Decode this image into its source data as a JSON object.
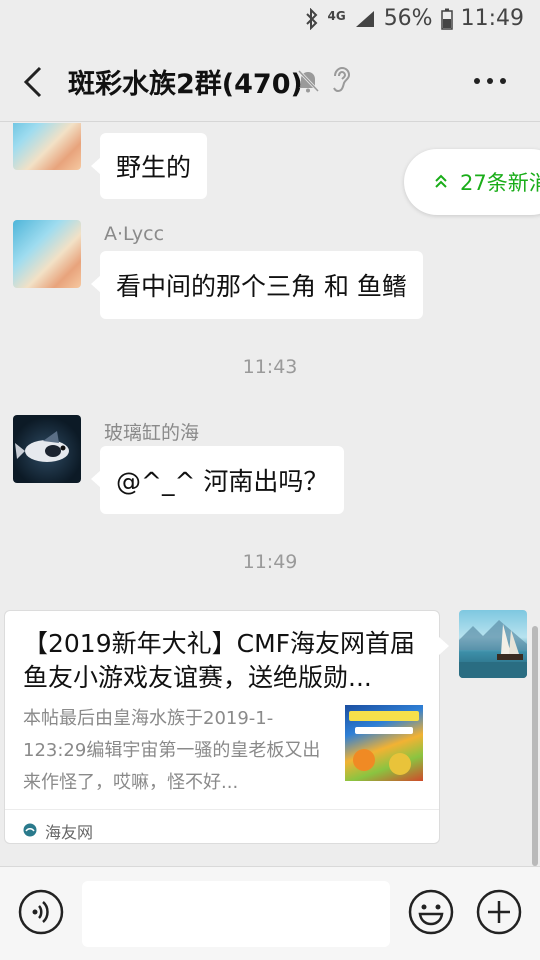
{
  "status_bar": {
    "network": "4G",
    "battery": "56%",
    "time": "11:49"
  },
  "header": {
    "title": "斑彩水族2群(470)"
  },
  "new_messages": {
    "label": "27条新消"
  },
  "messages": [
    {
      "sender": "A·Lycc",
      "text": "野生的"
    },
    {
      "sender": "A·Lycc",
      "text": "看中间的那个三角  和 鱼鳍"
    },
    {
      "timestamp": "11:43"
    },
    {
      "sender": "玻璃缸的海",
      "text": "@^_^  河南出吗？"
    },
    {
      "timestamp": "11:49"
    }
  ],
  "link_card": {
    "title": "【2019新年大礼】CMF海友网首届鱼友小游戏友谊赛，送绝版勋...",
    "description": "本帖最后由皇海水族于2019-1-123:29编辑宇宙第一骚的皇老板又出来作怪了，哎嘛，怪不好...",
    "source": "海友网"
  },
  "input_bar": {
    "placeholder": ""
  },
  "colors": {
    "background": "#ededed",
    "accent_green": "#1aad19",
    "bubble": "#ffffff"
  }
}
